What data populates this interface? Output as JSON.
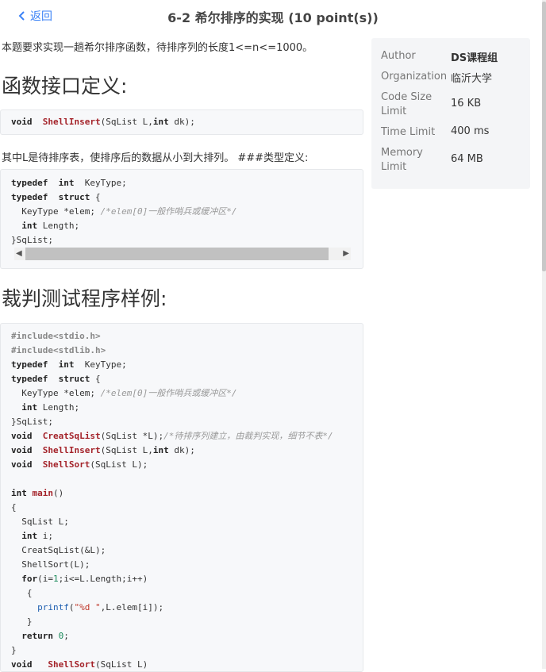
{
  "header": {
    "back_label": "返回",
    "title": "6-2 希尔排序的实现 (10 point(s))"
  },
  "content": {
    "intro": "本题要求实现一趟希尔排序函数，待排序列的长度1<=n<=1000。",
    "heading_interface": "函数接口定义:",
    "heading_sample": "裁判测试程序样例:",
    "para_types": "其中L是待排序表，使排序后的数据从小到大排列。 ###类型定义:"
  },
  "info": {
    "author_label": "Author",
    "author_value": "DS课程组",
    "org_label": "Organization",
    "org_value": "临沂大学",
    "codesize_label": "Code Size Limit",
    "codesize_value": "16 KB",
    "time_label": "Time Limit",
    "time_value": "400 ms",
    "memory_label": "Memory Limit",
    "memory_value": "64 MB"
  },
  "code": {
    "interface": "void  ShellInsert(SqList L,int dk);",
    "types": [
      "typedef  int  KeyType;",
      "typedef  struct {",
      "  KeyType *elem; /*elem[0]一般作哨兵或缓冲区*/",
      "  int Length;",
      "}SqList;"
    ],
    "sample": [
      "#include<stdio.h>",
      "#include<stdlib.h>",
      "typedef  int  KeyType;",
      "typedef  struct {",
      "  KeyType *elem; /*elem[0]一般作哨兵或缓冲区*/",
      "  int Length;",
      "}SqList;",
      "void  CreatSqList(SqList *L);/*待排序列建立，由裁判实现，细节不表*/",
      "void  ShellInsert(SqList L,int dk);",
      "void  ShellSort(SqList L);",
      "",
      "int main()",
      "{",
      "  SqList L;",
      "  int i;",
      "  CreatSqList(&L);",
      "  ShellSort(L);",
      "  for(i=1;i<=L.Length;i++)",
      "   {",
      "     printf(\"%d \",L.elem[i]);",
      "   }",
      "  return 0;",
      "}",
      "void   ShellSort(SqList L)"
    ]
  }
}
